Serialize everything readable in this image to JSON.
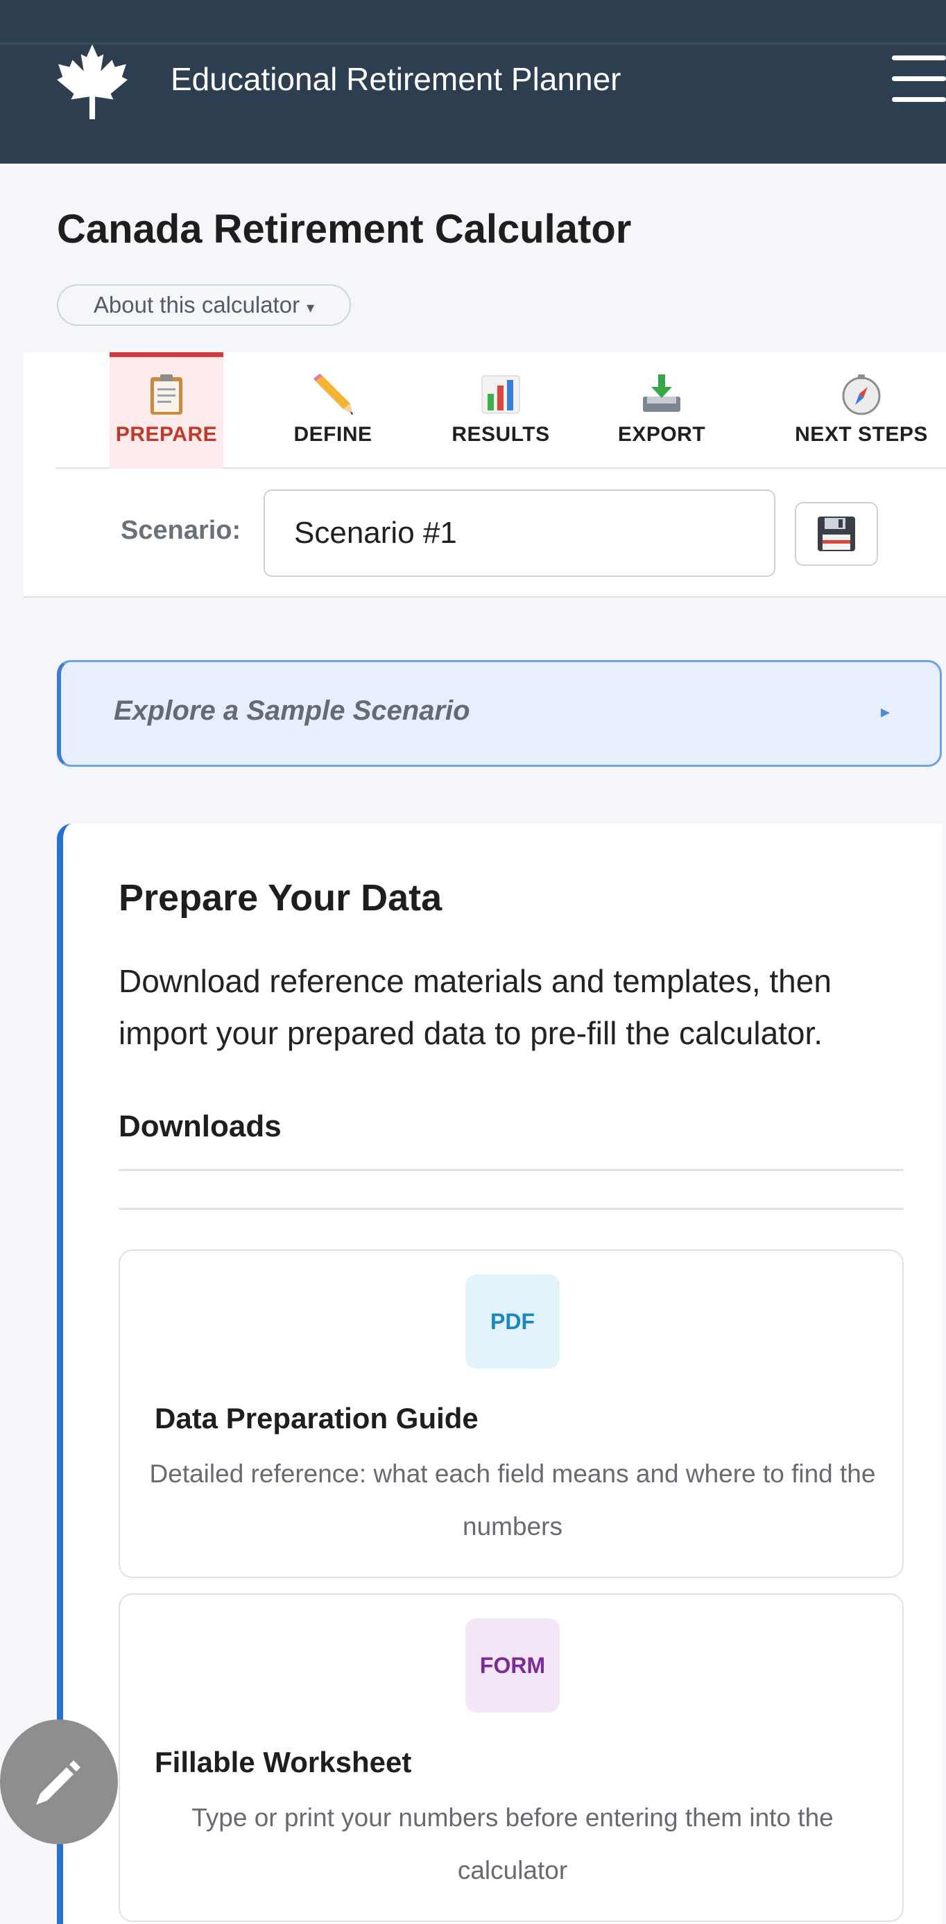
{
  "header": {
    "app_title": "Educational Retirement Planner",
    "logo_icon": "maple-leaf-icon",
    "menu_icon": "hamburger-menu-icon"
  },
  "page": {
    "title": "Canada Retirement Calculator",
    "about_label": "About this calculator",
    "about_caret": "▾"
  },
  "steps": [
    {
      "label": "PREPARE",
      "icon": "clipboard-icon",
      "active": true
    },
    {
      "label": "DEFINE",
      "icon": "pencil-icon",
      "active": false
    },
    {
      "label": "RESULTS",
      "icon": "bar-chart-icon",
      "active": false
    },
    {
      "label": "EXPORT",
      "icon": "download-tray-icon",
      "active": false
    },
    {
      "label": "NEXT STEPS",
      "icon": "compass-icon",
      "active": false
    }
  ],
  "scenario": {
    "label": "Scenario:",
    "value": "Scenario #1",
    "save_icon": "floppy-disk-icon"
  },
  "sample": {
    "label": "Explore a Sample Scenario",
    "arrow": "▸"
  },
  "prepare": {
    "title": "Prepare Your Data",
    "description": "Download reference materials and templates, then import your prepared data to pre-fill the calculator.",
    "downloads_title": "Downloads",
    "downloads": [
      {
        "badge": "PDF",
        "name": "Data Preparation Guide",
        "description": "Detailed reference: what each field means and where to find the numbers",
        "badge_bg": "#e3f3fb",
        "badge_color": "#1c86c0"
      },
      {
        "badge": "FORM",
        "name": "Fillable Worksheet",
        "description": "Type or print your numbers before entering them into the calculator",
        "badge_bg": "#f3e6f6",
        "badge_color": "#7b2a9a"
      }
    ]
  },
  "colors": {
    "header_bg": "#2c3e50",
    "active_tab": "#c0392b",
    "accent_blue": "#2573cf"
  },
  "fab_icon": "edit-pencil-icon"
}
